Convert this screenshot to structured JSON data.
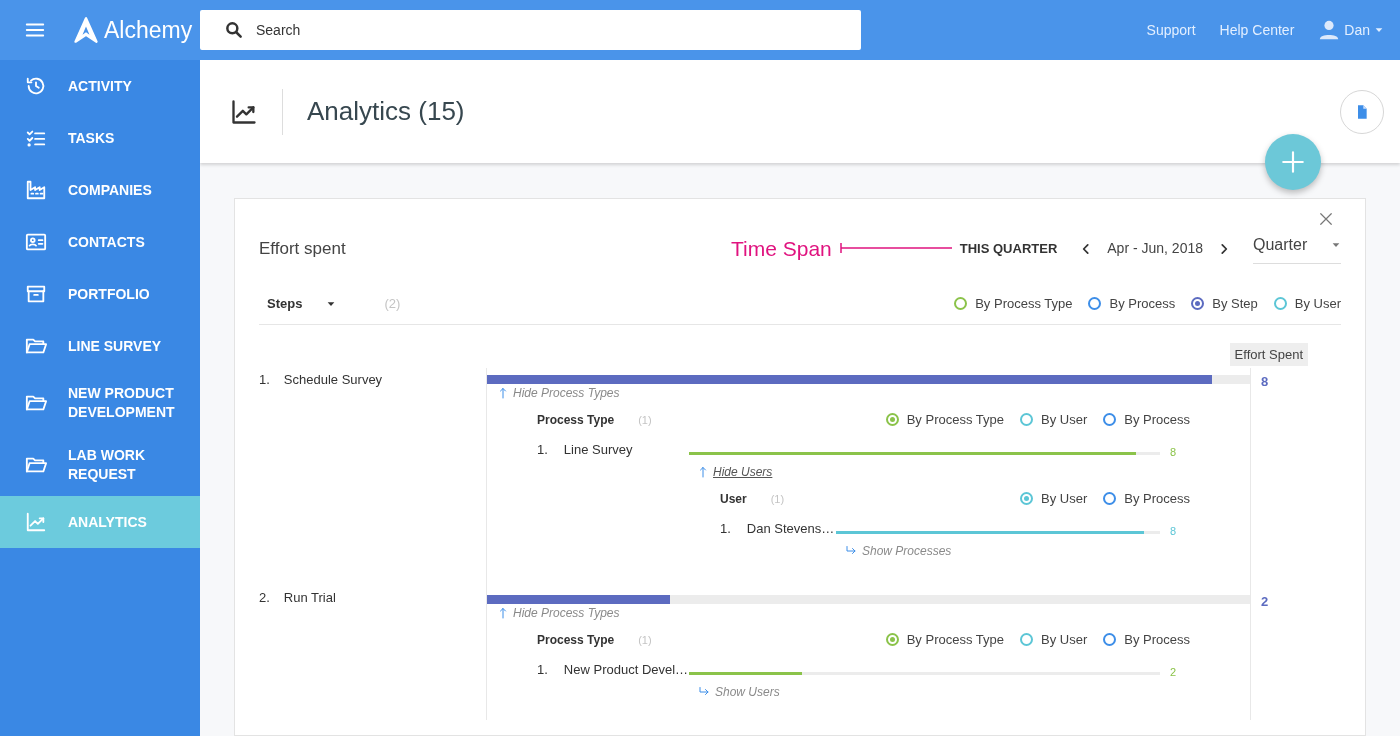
{
  "header": {
    "logo": "Alchemy",
    "search": {
      "placeholder": "Search"
    },
    "links": [
      "Support",
      "Help Center"
    ],
    "user": "Dan"
  },
  "sidebar": {
    "items": [
      {
        "label": "ACTIVITY",
        "selected": false
      },
      {
        "label": "TASKS",
        "selected": false
      },
      {
        "label": "COMPANIES",
        "selected": false
      },
      {
        "label": "CONTACTS",
        "selected": false
      },
      {
        "label": "PORTFOLIO",
        "selected": false
      },
      {
        "label": "LINE SURVEY",
        "selected": false
      },
      {
        "label": "NEW PRODUCT DEVELOPMENT",
        "selected": false
      },
      {
        "label": "LAB WORK REQUEST",
        "selected": false
      },
      {
        "label": "ANALYTICS",
        "selected": true
      }
    ]
  },
  "page": {
    "title": "Analytics (15)"
  },
  "card": {
    "title": "Effort spent",
    "annotation": "Time Span",
    "span_label": "THIS QUARTER",
    "range": "Apr - Jun, 2018",
    "period": "Quarter",
    "group": {
      "label": "Steps",
      "count": "(2)",
      "options": [
        {
          "label": "By Process Type",
          "color": "#8bc34a",
          "selected": false
        },
        {
          "label": "By Process",
          "color": "#3d8ee8",
          "selected": false
        },
        {
          "label": "By Step",
          "color": "#5c6bc0",
          "selected": true
        },
        {
          "label": "By User",
          "color": "#5cc6d6",
          "selected": false
        }
      ]
    },
    "value_header": "Effort Spent",
    "items": [
      {
        "number": "1.",
        "name": "Schedule Survey",
        "level": 0.95,
        "value": "8",
        "toggle": {
          "text": "Hide Process Types",
          "expanded": true,
          "hovered": false
        },
        "group": {
          "label": "Process Type",
          "count": "(1)",
          "options": [
            {
              "label": "By Process Type",
              "color": "#8bc34a",
              "selected": true
            },
            {
              "label": "By User",
              "color": "#5cc6d6",
              "selected": false
            },
            {
              "label": "By Process",
              "color": "#3d8ee8",
              "selected": false
            }
          ],
          "items": [
            {
              "number": "1.",
              "name": "Line Survey",
              "level": 0.95,
              "value": "8",
              "toggle": {
                "text": "Hide Users",
                "expanded": true,
                "hovered": true
              },
              "group": {
                "label": "User",
                "count": "(1)",
                "options": [
                  {
                    "label": "By User",
                    "color": "#5cc6d6",
                    "selected": true
                  },
                  {
                    "label": "By Process",
                    "color": "#3d8ee8",
                    "selected": false
                  }
                ],
                "items": [
                  {
                    "number": "1.",
                    "name": "Dan Stevens…",
                    "level": 0.95,
                    "value": "8",
                    "toggle": {
                      "text": "Show Processes",
                      "expanded": false,
                      "hovered": false
                    }
                  }
                ]
              }
            }
          ]
        }
      },
      {
        "number": "2.",
        "name": "Run Trial",
        "level": 0.24,
        "value": "2",
        "toggle": {
          "text": "Hide Process Types",
          "expanded": true,
          "hovered": false
        },
        "group": {
          "label": "Process Type",
          "count": "(1)",
          "options": [
            {
              "label": "By Process Type",
              "color": "#8bc34a",
              "selected": true
            },
            {
              "label": "By User",
              "color": "#5cc6d6",
              "selected": false
            },
            {
              "label": "By Process",
              "color": "#3d8ee8",
              "selected": false
            }
          ],
          "items": [
            {
              "number": "1.",
              "name": "New Product Devel…",
              "level": 0.24,
              "value": "2",
              "toggle": {
                "text": "Show Users",
                "expanded": false,
                "hovered": false
              }
            }
          ]
        }
      }
    ]
  }
}
